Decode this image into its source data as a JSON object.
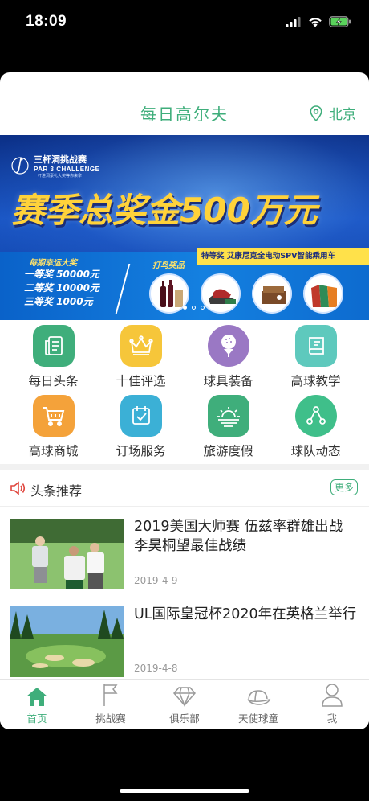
{
  "status": {
    "time": "18:09"
  },
  "header": {
    "title": "每日高尔夫",
    "city": "北京"
  },
  "banner": {
    "brand_cn": "三杆洞挑战赛",
    "brand_en": "PAR 3 CHALLENGE",
    "brand_sub": "一杆进洞豪礼大奖等你来拿",
    "headline": "赛季总奖金500万元",
    "lucky_title": "每期幸运大奖",
    "lucky_items": [
      "一等奖 50000元",
      "二等奖 10000元",
      "三等奖 1000元"
    ],
    "birdie_title": "打鸟奖品",
    "special": "特等奖   艾康尼克全电动SPV智能乘用车"
  },
  "menu": [
    {
      "label": "每日头条",
      "icon": "news-doc-icon",
      "color": "#3fae7b"
    },
    {
      "label": "十佳评选",
      "icon": "crown-icon",
      "color": "#f6c63a"
    },
    {
      "label": "球具装备",
      "icon": "golf-ball-tee-icon",
      "color": "#9a78c4"
    },
    {
      "label": "高球教学",
      "icon": "book-icon",
      "color": "#5ec9bd"
    },
    {
      "label": "高球商城",
      "icon": "cart-icon",
      "color": "#f4a23a"
    },
    {
      "label": "订场服务",
      "icon": "calendar-check-icon",
      "color": "#3bb0d6"
    },
    {
      "label": "旅游度假",
      "icon": "sunrise-icon",
      "color": "#3fae7b"
    },
    {
      "label": "球队动态",
      "icon": "share-nodes-icon",
      "color": "#3fbf8a"
    }
  ],
  "news": {
    "section_title": "头条推荐",
    "more": "更多",
    "items": [
      {
        "title": "2019美国大师赛 伍兹率群雄出战 李昊桐望最佳战绩",
        "date": "2019-4-9"
      },
      {
        "title": "UL国际皇冠杯2020年在英格兰举行",
        "date": "2019-4-8"
      }
    ]
  },
  "tabs": [
    {
      "label": "首页",
      "icon": "home-icon",
      "active": true
    },
    {
      "label": "挑战赛",
      "icon": "flag-icon",
      "active": false
    },
    {
      "label": "俱乐部",
      "icon": "diamond-icon",
      "active": false
    },
    {
      "label": "天使球童",
      "icon": "cap-icon",
      "active": false
    },
    {
      "label": "我",
      "icon": "person-icon",
      "active": false
    }
  ],
  "colors": {
    "accent": "#3fae7b"
  }
}
